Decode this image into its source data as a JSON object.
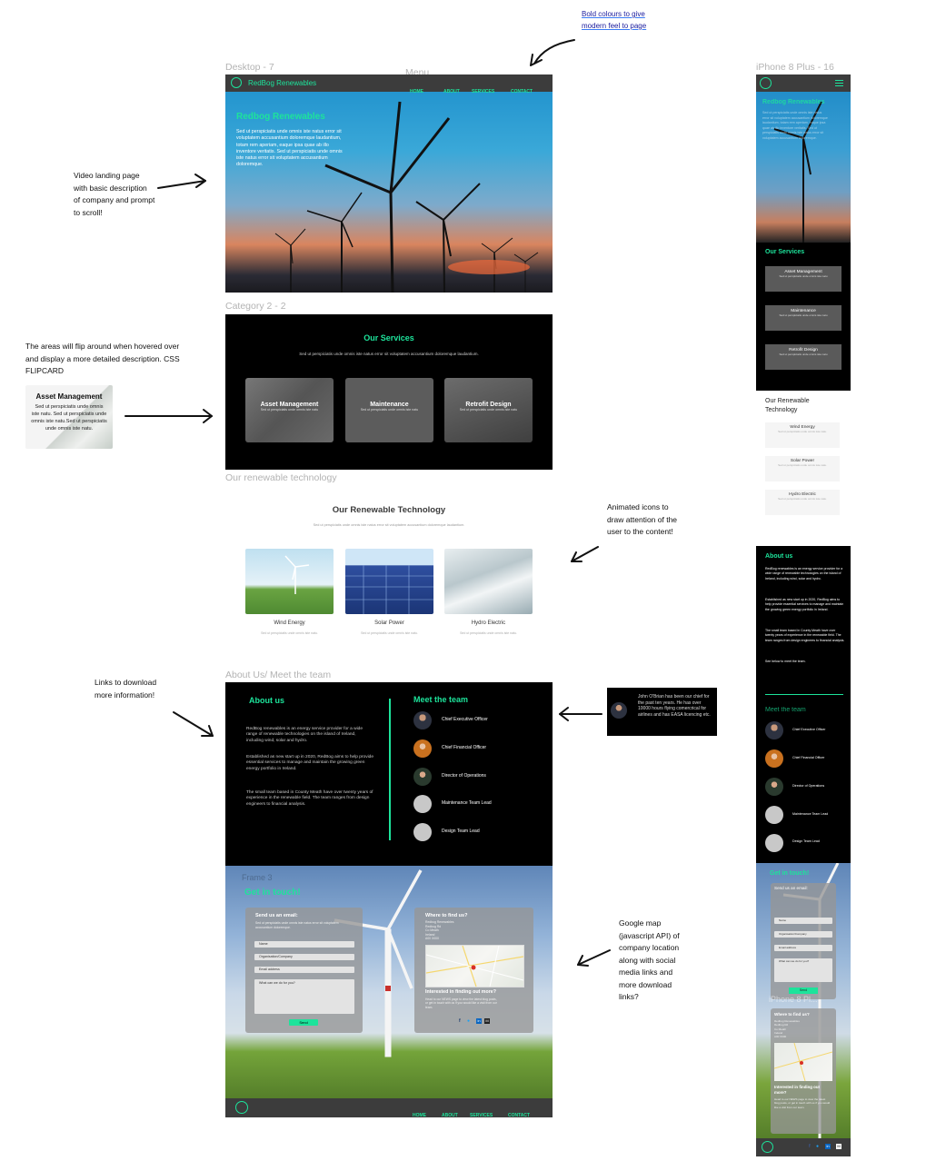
{
  "annotations": {
    "bold_colours": "Bold colours to give modern feel to page",
    "video_landing": "Video landing page with basic description of company and prompt to scroll!",
    "flip_areas": "The areas will flip around when hovered over and display a more detailed description. CSS FLIPCARD",
    "animated_icons": "Animated icons to draw attention of the user to the content!",
    "links_download": "Links to download more information!",
    "google_map": "Google map (javascript API) of company location along with social media links and more download links?"
  },
  "frame_labels": {
    "desktop": "Desktop - 7",
    "menu": "Menu",
    "iphone_top": "iPhone 8 Plus - 16",
    "category": "Category 2 - 2",
    "renewable": "Our renewable technology",
    "about": "About Us/ Meet the team",
    "frame3": "Frame 3",
    "iphone_bottom": "iPhone 8 Pl..."
  },
  "brand": {
    "name": "RedBog Renewables"
  },
  "nav": [
    "HOME",
    "ABOUT",
    "SERVICES",
    "CONTACT"
  ],
  "hero": {
    "title": "Redbog Renewables",
    "text": "Sed ut perspiciatis unde omnis iste natus error sit voluptatem accusantium doloremque laudantium, totam rem aperiam, eaque ipsa quae ab illo inventore veritatis. Sed ut perspiciatis unde omnis iste natus error sit voluptatem accusantium doloremque."
  },
  "services": {
    "title": "Our Services",
    "subtitle": "Sed ut perspiciatis unde omnis iste natus error sit voluptatem accusantium doloremque laudantium.",
    "cards": [
      {
        "title": "Asset Management",
        "text": "Sed ut perspiciatis unde omnis iste natu"
      },
      {
        "title": "Maintenance",
        "text": "Sed ut perspiciatis unde omnis iste natu"
      },
      {
        "title": "Retrofit Design",
        "text": "Sed ut perspiciatis unde omnis iste natu"
      }
    ],
    "flip_example": {
      "title": "Asset Management",
      "text": "Sed ut perspiciatis unde omnis iste natu. Sed ut perspiciatis unde omnis iste natu.Sed ut perspiciatis unde omnis iste natu."
    }
  },
  "tech": {
    "title": "Our Renewable Technology",
    "subtitle": "Sed ut perspiciatis unde omnis iste natus error sit voluptatem accusantium doloremque laudantium.",
    "items": [
      {
        "title": "Wind Energy",
        "text": "Sed ut perspiciatis unde omnis iste natu."
      },
      {
        "title": "Solar Power",
        "text": "Sed ut perspiciatis unde omnis iste natu."
      },
      {
        "title": "Hydro Electric",
        "text": "Sed ut perspiciatis unde omnis iste natu."
      }
    ]
  },
  "about": {
    "title": "About us",
    "p1": "RedBog renewables is an energy service provider for a wide range of renewable technologies on the island of Ireland, including wind, solar and hydro.",
    "p2": "Established as new start up in 2020, RedBog aims to help provide essential services to manage and maintain the growing green energy portfolio in Ireland.",
    "p3": "The small team based in County Meath have over twenty years of experience in the renewable field. The team ranges from design engineers to financial analysis.",
    "see_below": "See below to meet the team."
  },
  "team": {
    "title": "Meet the team",
    "members": [
      "Chief Executive Officer",
      "Chief Financial Officer",
      "Director of Operations",
      "Maintenance Team Lead",
      "Design Team Lead"
    ],
    "popup": "John O'Brian has been our chief for the past ten years. He has over 10000 hours flying comercrical for airlines and has EASA licencing etc."
  },
  "contact": {
    "title": "Get in touch!",
    "email_title": "Send us an email:",
    "email_text": "Sed ut perspiciatis unde omnis iste natus error sit voluptatem accusantium doloremque.",
    "fields": [
      "Name",
      "Organisation/Company",
      "Email address",
      "What can we do for you?"
    ],
    "send": "Send",
    "where_title": "Where to find us?",
    "address": "Redbog Renewables\nRedbog Rd\nCo Meath\nIreland\nA00 X000",
    "interested_title": "Interested in finding out more?",
    "interested_text": "Head to our NEWS page to view the latest blog posts, or get in touch with us if you would like a visit from our team."
  },
  "mobile": {
    "tech_title": "Our Renewable Technology"
  }
}
